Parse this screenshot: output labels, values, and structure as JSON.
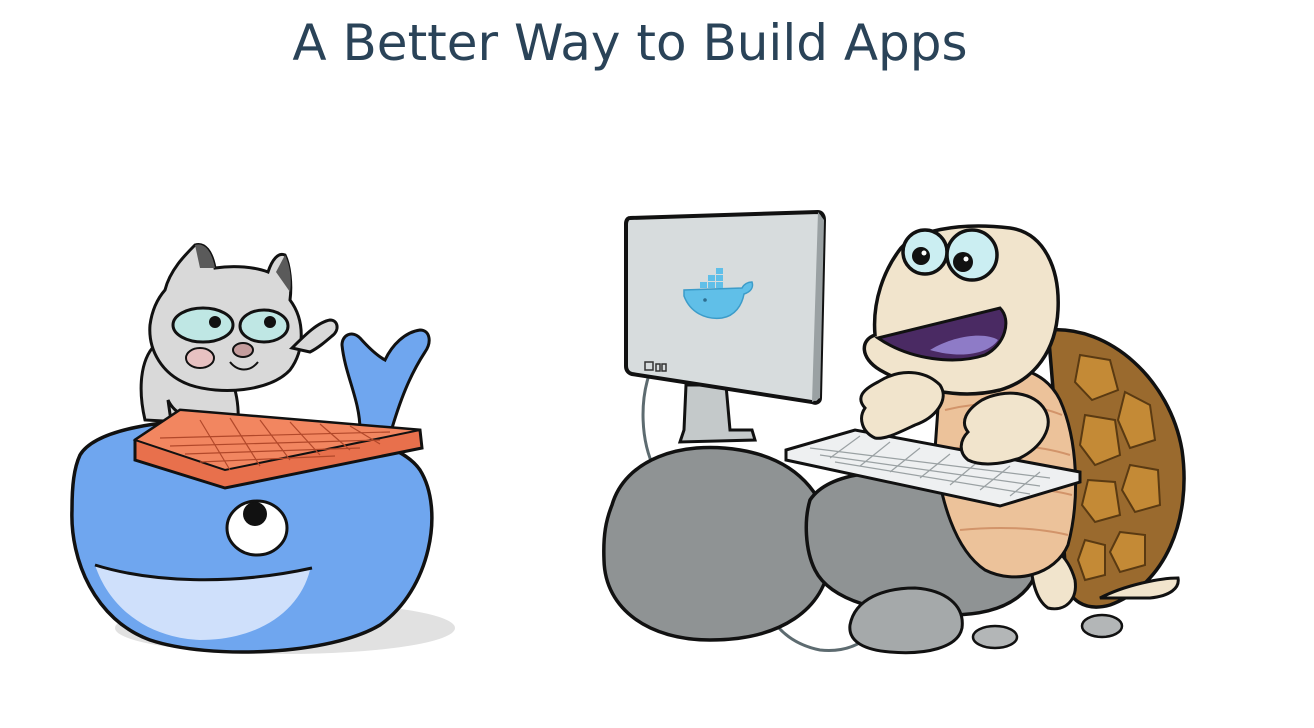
{
  "page": {
    "headline": "A Better Way to Build Apps"
  },
  "illustration": {
    "left_scene": "whale-with-cat-icon",
    "right_scene": "turtle-at-computer-icon",
    "monitor_logo": "docker-whale-logo-icon"
  },
  "colors": {
    "headline": "#2a4358",
    "whale_blue": "#6fa6ef",
    "whale_light": "#cfe0fb",
    "cat_gray": "#d9d9d9",
    "keyboard_orange": "#e8704c",
    "rock_gray": "#8f9394",
    "shell_brown": "#9a6a2e",
    "turtle_skin": "#f1e4cc",
    "monitor_screen": "#d7dcdd",
    "docker_logo": "#60bfe8"
  }
}
